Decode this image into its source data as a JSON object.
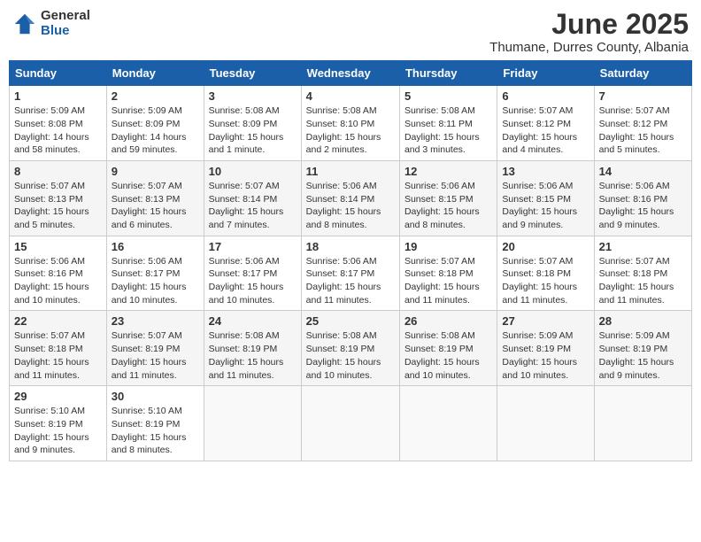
{
  "logo": {
    "general": "General",
    "blue": "Blue"
  },
  "title": {
    "month_year": "June 2025",
    "location": "Thumane, Durres County, Albania"
  },
  "weekdays": [
    "Sunday",
    "Monday",
    "Tuesday",
    "Wednesday",
    "Thursday",
    "Friday",
    "Saturday"
  ],
  "weeks": [
    [
      {
        "day": "1",
        "sunrise": "5:09 AM",
        "sunset": "8:08 PM",
        "daylight": "14 hours and 58 minutes."
      },
      {
        "day": "2",
        "sunrise": "5:09 AM",
        "sunset": "8:09 PM",
        "daylight": "14 hours and 59 minutes."
      },
      {
        "day": "3",
        "sunrise": "5:08 AM",
        "sunset": "8:09 PM",
        "daylight": "15 hours and 1 minute."
      },
      {
        "day": "4",
        "sunrise": "5:08 AM",
        "sunset": "8:10 PM",
        "daylight": "15 hours and 2 minutes."
      },
      {
        "day": "5",
        "sunrise": "5:08 AM",
        "sunset": "8:11 PM",
        "daylight": "15 hours and 3 minutes."
      },
      {
        "day": "6",
        "sunrise": "5:07 AM",
        "sunset": "8:12 PM",
        "daylight": "15 hours and 4 minutes."
      },
      {
        "day": "7",
        "sunrise": "5:07 AM",
        "sunset": "8:12 PM",
        "daylight": "15 hours and 5 minutes."
      }
    ],
    [
      {
        "day": "8",
        "sunrise": "5:07 AM",
        "sunset": "8:13 PM",
        "daylight": "15 hours and 5 minutes."
      },
      {
        "day": "9",
        "sunrise": "5:07 AM",
        "sunset": "8:13 PM",
        "daylight": "15 hours and 6 minutes."
      },
      {
        "day": "10",
        "sunrise": "5:07 AM",
        "sunset": "8:14 PM",
        "daylight": "15 hours and 7 minutes."
      },
      {
        "day": "11",
        "sunrise": "5:06 AM",
        "sunset": "8:14 PM",
        "daylight": "15 hours and 8 minutes."
      },
      {
        "day": "12",
        "sunrise": "5:06 AM",
        "sunset": "8:15 PM",
        "daylight": "15 hours and 8 minutes."
      },
      {
        "day": "13",
        "sunrise": "5:06 AM",
        "sunset": "8:15 PM",
        "daylight": "15 hours and 9 minutes."
      },
      {
        "day": "14",
        "sunrise": "5:06 AM",
        "sunset": "8:16 PM",
        "daylight": "15 hours and 9 minutes."
      }
    ],
    [
      {
        "day": "15",
        "sunrise": "5:06 AM",
        "sunset": "8:16 PM",
        "daylight": "15 hours and 10 minutes."
      },
      {
        "day": "16",
        "sunrise": "5:06 AM",
        "sunset": "8:17 PM",
        "daylight": "15 hours and 10 minutes."
      },
      {
        "day": "17",
        "sunrise": "5:06 AM",
        "sunset": "8:17 PM",
        "daylight": "15 hours and 10 minutes."
      },
      {
        "day": "18",
        "sunrise": "5:06 AM",
        "sunset": "8:17 PM",
        "daylight": "15 hours and 11 minutes."
      },
      {
        "day": "19",
        "sunrise": "5:07 AM",
        "sunset": "8:18 PM",
        "daylight": "15 hours and 11 minutes."
      },
      {
        "day": "20",
        "sunrise": "5:07 AM",
        "sunset": "8:18 PM",
        "daylight": "15 hours and 11 minutes."
      },
      {
        "day": "21",
        "sunrise": "5:07 AM",
        "sunset": "8:18 PM",
        "daylight": "15 hours and 11 minutes."
      }
    ],
    [
      {
        "day": "22",
        "sunrise": "5:07 AM",
        "sunset": "8:18 PM",
        "daylight": "15 hours and 11 minutes."
      },
      {
        "day": "23",
        "sunrise": "5:07 AM",
        "sunset": "8:19 PM",
        "daylight": "15 hours and 11 minutes."
      },
      {
        "day": "24",
        "sunrise": "5:08 AM",
        "sunset": "8:19 PM",
        "daylight": "15 hours and 11 minutes."
      },
      {
        "day": "25",
        "sunrise": "5:08 AM",
        "sunset": "8:19 PM",
        "daylight": "15 hours and 10 minutes."
      },
      {
        "day": "26",
        "sunrise": "5:08 AM",
        "sunset": "8:19 PM",
        "daylight": "15 hours and 10 minutes."
      },
      {
        "day": "27",
        "sunrise": "5:09 AM",
        "sunset": "8:19 PM",
        "daylight": "15 hours and 10 minutes."
      },
      {
        "day": "28",
        "sunrise": "5:09 AM",
        "sunset": "8:19 PM",
        "daylight": "15 hours and 9 minutes."
      }
    ],
    [
      {
        "day": "29",
        "sunrise": "5:10 AM",
        "sunset": "8:19 PM",
        "daylight": "15 hours and 9 minutes."
      },
      {
        "day": "30",
        "sunrise": "5:10 AM",
        "sunset": "8:19 PM",
        "daylight": "15 hours and 8 minutes."
      },
      null,
      null,
      null,
      null,
      null
    ]
  ]
}
